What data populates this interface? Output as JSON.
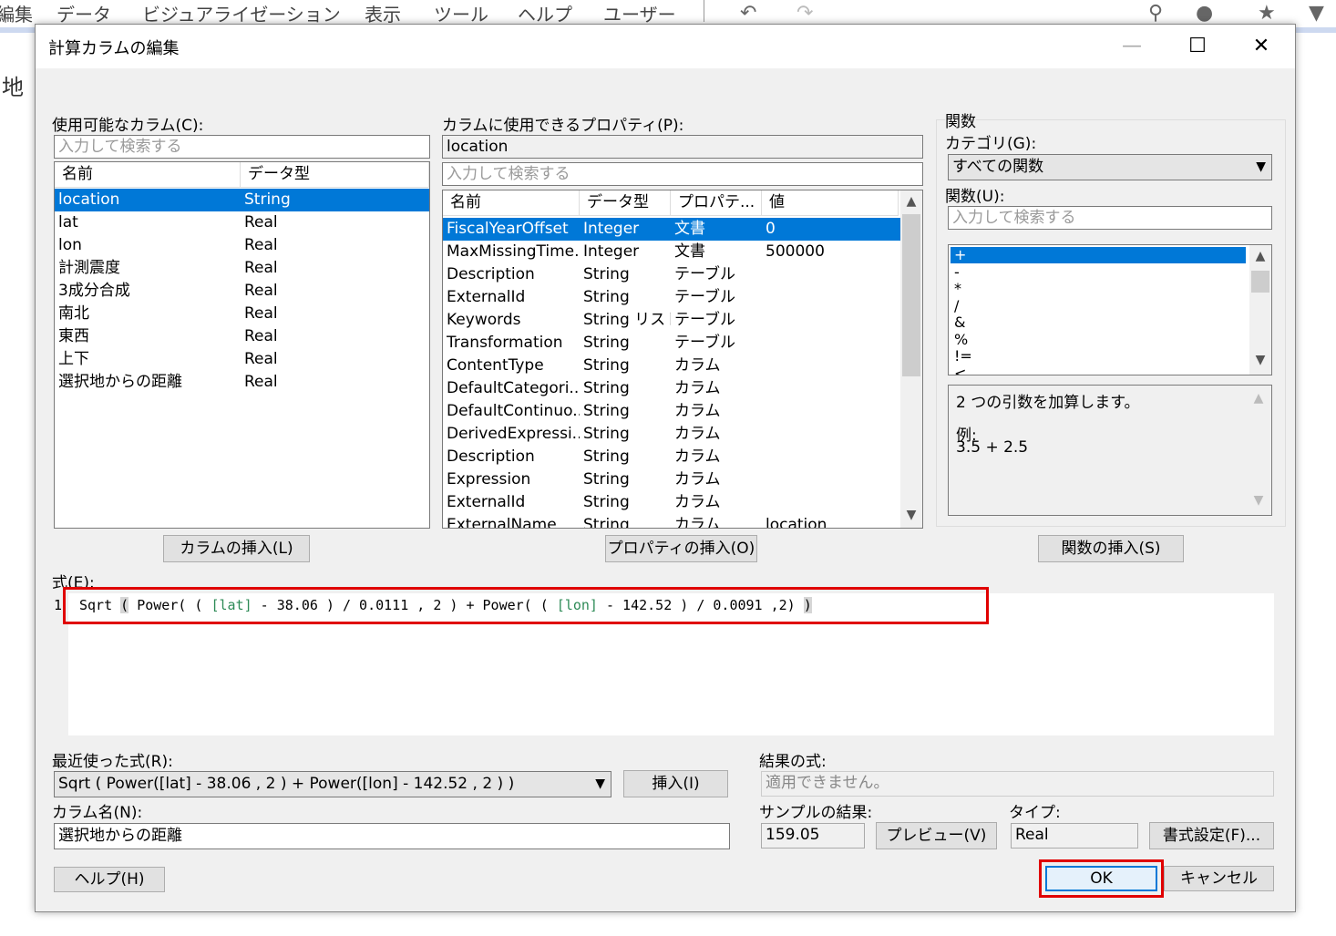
{
  "menu": [
    "編集",
    "データ",
    "ビジュアライゼーション",
    "表示",
    "ツール",
    "ヘルプ",
    "ユーザー"
  ],
  "background_text": "地",
  "dialog": {
    "title": "計算カラムの編集",
    "window_controls": {
      "minimize": "—",
      "maximize": "☐",
      "close": "✕"
    },
    "available_columns": {
      "label": "使用可能なカラム(C):",
      "search_placeholder": "入力して検索する",
      "headers": [
        "名前",
        "データ型"
      ],
      "rows": [
        [
          "location",
          "String"
        ],
        [
          "lat",
          "Real"
        ],
        [
          "lon",
          "Real"
        ],
        [
          "計測震度",
          "Real"
        ],
        [
          "3成分合成",
          "Real"
        ],
        [
          "南北",
          "Real"
        ],
        [
          "東西",
          "Real"
        ],
        [
          "上下",
          "Real"
        ],
        [
          "選択地からの距離",
          "Real"
        ]
      ],
      "selected_index": 0,
      "insert_button": "カラムの挿入(L)"
    },
    "properties": {
      "label": "カラムに使用できるプロパティ(P):",
      "column_value": "location",
      "search_placeholder": "入力して検索する",
      "headers": [
        "名前",
        "データ型",
        "プロパテ...",
        "値"
      ],
      "rows": [
        [
          "FiscalYearOffset",
          "Integer",
          "文書",
          "0"
        ],
        [
          "MaxMissingTime...",
          "Integer",
          "文書",
          "500000"
        ],
        [
          "Description",
          "String",
          "テーブル",
          ""
        ],
        [
          "ExternalId",
          "String",
          "テーブル",
          ""
        ],
        [
          "Keywords",
          "String リスト",
          "テーブル",
          ""
        ],
        [
          "Transformation",
          "String",
          "テーブル",
          ""
        ],
        [
          "ContentType",
          "String",
          "カラム",
          ""
        ],
        [
          "DefaultCategori...",
          "String",
          "カラム",
          ""
        ],
        [
          "DefaultContinuo...",
          "String",
          "カラム",
          ""
        ],
        [
          "DerivedExpressi...",
          "String",
          "カラム",
          ""
        ],
        [
          "Description",
          "String",
          "カラム",
          ""
        ],
        [
          "Expression",
          "String",
          "カラム",
          ""
        ],
        [
          "ExternalId",
          "String",
          "カラム",
          ""
        ],
        [
          "ExternalName",
          "String",
          "カラム",
          "location"
        ]
      ],
      "selected_index": 0,
      "insert_button": "プロパティの挿入(O)"
    },
    "functions": {
      "label": "関数",
      "category_label": "カテゴリ(G):",
      "category_value": "すべての関数",
      "function_label": "関数(U):",
      "search_placeholder": "入力して検索する",
      "items": [
        "+",
        "-",
        "*",
        "/",
        "&",
        "%",
        "!=",
        "<"
      ],
      "selected_index": 0,
      "description": "2 つの引数を加算します。",
      "example_label": "例:",
      "example_value": "3.5 + 2.5",
      "insert_button": "関数の挿入(S)"
    },
    "expression": {
      "label": "式(E):",
      "line_number": "1",
      "tokens": [
        {
          "t": "Sqrt",
          "c": "fn"
        },
        {
          "t": " ",
          "c": "sp"
        },
        {
          "t": "(",
          "c": "hl"
        },
        {
          "t": " Power( ( ",
          "c": "fn"
        },
        {
          "t": "[lat]",
          "c": "col"
        },
        {
          "t": " - 38.06 ) / 0.0111 , 2 ) + Power( ( ",
          "c": "fn"
        },
        {
          "t": "[lon]",
          "c": "col"
        },
        {
          "t": " - 142.52 ) / 0.0091 ,2) ",
          "c": "fn"
        },
        {
          "t": ")",
          "c": "hl"
        }
      ]
    },
    "recent": {
      "label": "最近使った式(R):",
      "value": "Sqrt ( Power([lat] - 38.06 , 2 ) + Power([lon] - 142.52 , 2 ) )",
      "insert_button": "挿入(I)"
    },
    "column_name": {
      "label": "カラム名(N):",
      "value": "選択地からの距離"
    },
    "result": {
      "label": "結果の式:",
      "value": "適用できません。",
      "sample_label": "サンプルの結果:",
      "sample_value": "159.05",
      "preview_button": "プレビュー(V)",
      "type_label": "タイプ:",
      "type_value": "Real",
      "format_button": "書式設定(F)..."
    },
    "help_button": "ヘルプ(H)",
    "ok_button": "OK",
    "cancel_button": "キャンセル"
  },
  "colors": {
    "selection": "#0078d7",
    "highlight_red": "#e00000",
    "column_ref": "#2e8b57",
    "dialog_bg": "#f0f0f0"
  }
}
